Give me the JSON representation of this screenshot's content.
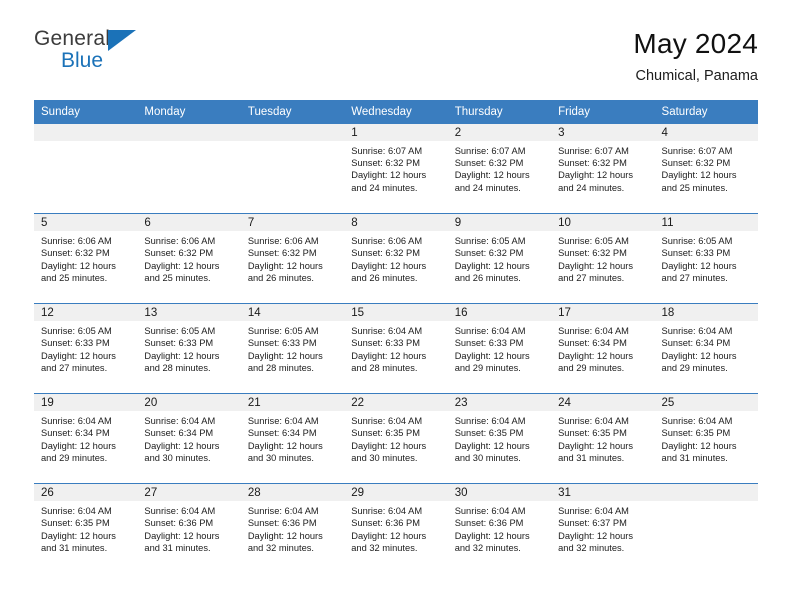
{
  "brand": {
    "name_top": "General",
    "name_bottom": "Blue",
    "triangle_color": "#1b72b8"
  },
  "header": {
    "title": "May 2024",
    "subtitle": "Chumical, Panama"
  },
  "theme": {
    "header_bg": "#3a7dbf",
    "header_text": "#ffffff",
    "daynum_bg": "#f0f0f0",
    "grid_line": "#3a7dbf",
    "cell_bg": "#ffffff"
  },
  "calendar": {
    "weekday_headers": [
      "Sunday",
      "Monday",
      "Tuesday",
      "Wednesday",
      "Thursday",
      "Friday",
      "Saturday"
    ],
    "weeks": [
      [
        {
          "day": "",
          "blank": true,
          "sunrise": "",
          "sunset": "",
          "daylight_line1": "",
          "daylight_line2": ""
        },
        {
          "day": "",
          "blank": true,
          "sunrise": "",
          "sunset": "",
          "daylight_line1": "",
          "daylight_line2": ""
        },
        {
          "day": "",
          "blank": true,
          "sunrise": "",
          "sunset": "",
          "daylight_line1": "",
          "daylight_line2": ""
        },
        {
          "day": "1",
          "blank": false,
          "sunrise": "Sunrise: 6:07 AM",
          "sunset": "Sunset: 6:32 PM",
          "daylight_line1": "Daylight: 12 hours",
          "daylight_line2": "and 24 minutes."
        },
        {
          "day": "2",
          "blank": false,
          "sunrise": "Sunrise: 6:07 AM",
          "sunset": "Sunset: 6:32 PM",
          "daylight_line1": "Daylight: 12 hours",
          "daylight_line2": "and 24 minutes."
        },
        {
          "day": "3",
          "blank": false,
          "sunrise": "Sunrise: 6:07 AM",
          "sunset": "Sunset: 6:32 PM",
          "daylight_line1": "Daylight: 12 hours",
          "daylight_line2": "and 24 minutes."
        },
        {
          "day": "4",
          "blank": false,
          "sunrise": "Sunrise: 6:07 AM",
          "sunset": "Sunset: 6:32 PM",
          "daylight_line1": "Daylight: 12 hours",
          "daylight_line2": "and 25 minutes."
        }
      ],
      [
        {
          "day": "5",
          "blank": false,
          "sunrise": "Sunrise: 6:06 AM",
          "sunset": "Sunset: 6:32 PM",
          "daylight_line1": "Daylight: 12 hours",
          "daylight_line2": "and 25 minutes."
        },
        {
          "day": "6",
          "blank": false,
          "sunrise": "Sunrise: 6:06 AM",
          "sunset": "Sunset: 6:32 PM",
          "daylight_line1": "Daylight: 12 hours",
          "daylight_line2": "and 25 minutes."
        },
        {
          "day": "7",
          "blank": false,
          "sunrise": "Sunrise: 6:06 AM",
          "sunset": "Sunset: 6:32 PM",
          "daylight_line1": "Daylight: 12 hours",
          "daylight_line2": "and 26 minutes."
        },
        {
          "day": "8",
          "blank": false,
          "sunrise": "Sunrise: 6:06 AM",
          "sunset": "Sunset: 6:32 PM",
          "daylight_line1": "Daylight: 12 hours",
          "daylight_line2": "and 26 minutes."
        },
        {
          "day": "9",
          "blank": false,
          "sunrise": "Sunrise: 6:05 AM",
          "sunset": "Sunset: 6:32 PM",
          "daylight_line1": "Daylight: 12 hours",
          "daylight_line2": "and 26 minutes."
        },
        {
          "day": "10",
          "blank": false,
          "sunrise": "Sunrise: 6:05 AM",
          "sunset": "Sunset: 6:32 PM",
          "daylight_line1": "Daylight: 12 hours",
          "daylight_line2": "and 27 minutes."
        },
        {
          "day": "11",
          "blank": false,
          "sunrise": "Sunrise: 6:05 AM",
          "sunset": "Sunset: 6:33 PM",
          "daylight_line1": "Daylight: 12 hours",
          "daylight_line2": "and 27 minutes."
        }
      ],
      [
        {
          "day": "12",
          "blank": false,
          "sunrise": "Sunrise: 6:05 AM",
          "sunset": "Sunset: 6:33 PM",
          "daylight_line1": "Daylight: 12 hours",
          "daylight_line2": "and 27 minutes."
        },
        {
          "day": "13",
          "blank": false,
          "sunrise": "Sunrise: 6:05 AM",
          "sunset": "Sunset: 6:33 PM",
          "daylight_line1": "Daylight: 12 hours",
          "daylight_line2": "and 28 minutes."
        },
        {
          "day": "14",
          "blank": false,
          "sunrise": "Sunrise: 6:05 AM",
          "sunset": "Sunset: 6:33 PM",
          "daylight_line1": "Daylight: 12 hours",
          "daylight_line2": "and 28 minutes."
        },
        {
          "day": "15",
          "blank": false,
          "sunrise": "Sunrise: 6:04 AM",
          "sunset": "Sunset: 6:33 PM",
          "daylight_line1": "Daylight: 12 hours",
          "daylight_line2": "and 28 minutes."
        },
        {
          "day": "16",
          "blank": false,
          "sunrise": "Sunrise: 6:04 AM",
          "sunset": "Sunset: 6:33 PM",
          "daylight_line1": "Daylight: 12 hours",
          "daylight_line2": "and 29 minutes."
        },
        {
          "day": "17",
          "blank": false,
          "sunrise": "Sunrise: 6:04 AM",
          "sunset": "Sunset: 6:34 PM",
          "daylight_line1": "Daylight: 12 hours",
          "daylight_line2": "and 29 minutes."
        },
        {
          "day": "18",
          "blank": false,
          "sunrise": "Sunrise: 6:04 AM",
          "sunset": "Sunset: 6:34 PM",
          "daylight_line1": "Daylight: 12 hours",
          "daylight_line2": "and 29 minutes."
        }
      ],
      [
        {
          "day": "19",
          "blank": false,
          "sunrise": "Sunrise: 6:04 AM",
          "sunset": "Sunset: 6:34 PM",
          "daylight_line1": "Daylight: 12 hours",
          "daylight_line2": "and 29 minutes."
        },
        {
          "day": "20",
          "blank": false,
          "sunrise": "Sunrise: 6:04 AM",
          "sunset": "Sunset: 6:34 PM",
          "daylight_line1": "Daylight: 12 hours",
          "daylight_line2": "and 30 minutes."
        },
        {
          "day": "21",
          "blank": false,
          "sunrise": "Sunrise: 6:04 AM",
          "sunset": "Sunset: 6:34 PM",
          "daylight_line1": "Daylight: 12 hours",
          "daylight_line2": "and 30 minutes."
        },
        {
          "day": "22",
          "blank": false,
          "sunrise": "Sunrise: 6:04 AM",
          "sunset": "Sunset: 6:35 PM",
          "daylight_line1": "Daylight: 12 hours",
          "daylight_line2": "and 30 minutes."
        },
        {
          "day": "23",
          "blank": false,
          "sunrise": "Sunrise: 6:04 AM",
          "sunset": "Sunset: 6:35 PM",
          "daylight_line1": "Daylight: 12 hours",
          "daylight_line2": "and 30 minutes."
        },
        {
          "day": "24",
          "blank": false,
          "sunrise": "Sunrise: 6:04 AM",
          "sunset": "Sunset: 6:35 PM",
          "daylight_line1": "Daylight: 12 hours",
          "daylight_line2": "and 31 minutes."
        },
        {
          "day": "25",
          "blank": false,
          "sunrise": "Sunrise: 6:04 AM",
          "sunset": "Sunset: 6:35 PM",
          "daylight_line1": "Daylight: 12 hours",
          "daylight_line2": "and 31 minutes."
        }
      ],
      [
        {
          "day": "26",
          "blank": false,
          "sunrise": "Sunrise: 6:04 AM",
          "sunset": "Sunset: 6:35 PM",
          "daylight_line1": "Daylight: 12 hours",
          "daylight_line2": "and 31 minutes."
        },
        {
          "day": "27",
          "blank": false,
          "sunrise": "Sunrise: 6:04 AM",
          "sunset": "Sunset: 6:36 PM",
          "daylight_line1": "Daylight: 12 hours",
          "daylight_line2": "and 31 minutes."
        },
        {
          "day": "28",
          "blank": false,
          "sunrise": "Sunrise: 6:04 AM",
          "sunset": "Sunset: 6:36 PM",
          "daylight_line1": "Daylight: 12 hours",
          "daylight_line2": "and 32 minutes."
        },
        {
          "day": "29",
          "blank": false,
          "sunrise": "Sunrise: 6:04 AM",
          "sunset": "Sunset: 6:36 PM",
          "daylight_line1": "Daylight: 12 hours",
          "daylight_line2": "and 32 minutes."
        },
        {
          "day": "30",
          "blank": false,
          "sunrise": "Sunrise: 6:04 AM",
          "sunset": "Sunset: 6:36 PM",
          "daylight_line1": "Daylight: 12 hours",
          "daylight_line2": "and 32 minutes."
        },
        {
          "day": "31",
          "blank": false,
          "sunrise": "Sunrise: 6:04 AM",
          "sunset": "Sunset: 6:37 PM",
          "daylight_line1": "Daylight: 12 hours",
          "daylight_line2": "and 32 minutes."
        },
        {
          "day": "",
          "blank": true,
          "sunrise": "",
          "sunset": "",
          "daylight_line1": "",
          "daylight_line2": ""
        }
      ]
    ]
  }
}
